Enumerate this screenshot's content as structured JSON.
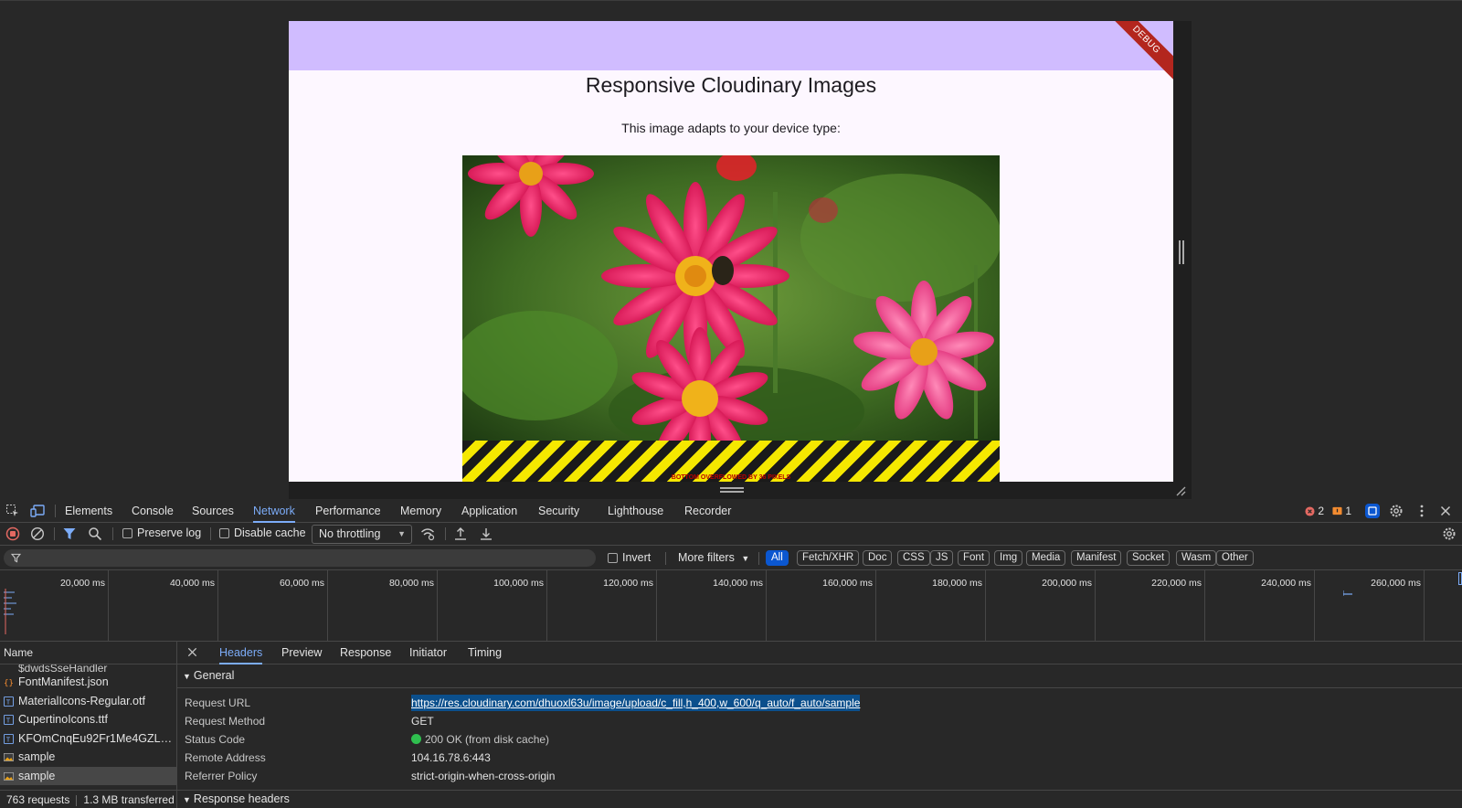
{
  "app": {
    "debug_label": "DEBUG",
    "title": "Responsive Cloudinary Images",
    "subtitle": "This image adapts to your device type:",
    "overflow_label": "BOTTOM OVERFLOWED BY 36 PIXELS"
  },
  "devtools": {
    "tabs": [
      "Elements",
      "Console",
      "Sources",
      "Network",
      "Performance",
      "Memory",
      "Application",
      "Security",
      "Lighthouse",
      "Recorder"
    ],
    "active_tab": "Network",
    "errors_count": "2",
    "warnings_count": "1",
    "toolbar": {
      "preserve_log": "Preserve log",
      "disable_cache": "Disable cache",
      "throttling": "No throttling"
    },
    "filter": {
      "placeholder": "",
      "invert": "Invert",
      "more_filters": "More filters",
      "types": [
        "All",
        "Fetch/XHR",
        "Doc",
        "CSS",
        "JS",
        "Font",
        "Img",
        "Media",
        "Manifest",
        "Socket",
        "Wasm",
        "Other"
      ],
      "active_type": "All"
    },
    "timeline": {
      "ticks": [
        "20,000 ms",
        "40,000 ms",
        "60,000 ms",
        "80,000 ms",
        "100,000 ms",
        "120,000 ms",
        "140,000 ms",
        "160,000 ms",
        "180,000 ms",
        "200,000 ms",
        "220,000 ms",
        "240,000 ms",
        "260,000 ms"
      ]
    },
    "requests": {
      "header": "Name",
      "cut_row": "$dwdsSseHandler",
      "rows": [
        {
          "name": "FontManifest.json",
          "icon": "json-icon"
        },
        {
          "name": "MaterialIcons-Regular.otf",
          "icon": "font-icon"
        },
        {
          "name": "CupertinoIcons.ttf",
          "icon": "font-icon"
        },
        {
          "name": "KFOmCnqEu92Fr1Me4GZLC...",
          "icon": "font-icon"
        },
        {
          "name": "sample",
          "icon": "image-icon"
        },
        {
          "name": "sample",
          "icon": "image-icon"
        }
      ],
      "status_requests": "763 requests",
      "status_transferred": "1.3 MB transferred"
    },
    "detail": {
      "tabs": [
        "Headers",
        "Preview",
        "Response",
        "Initiator",
        "Timing"
      ],
      "active_tab": "Headers",
      "general_title": "General",
      "rows": [
        {
          "key": "Request URL",
          "value": "https://res.cloudinary.com/dhuoxl63u/image/upload/c_fill,h_400,w_600/q_auto/f_auto/sample"
        },
        {
          "key": "Request Method",
          "value": "GET"
        },
        {
          "key": "Status Code",
          "value": "200 OK (from disk cache)"
        },
        {
          "key": "Remote Address",
          "value": "104.16.78.6:443"
        },
        {
          "key": "Referrer Policy",
          "value": "strict-origin-when-cross-origin"
        }
      ],
      "response_headers_title": "Response headers"
    }
  }
}
